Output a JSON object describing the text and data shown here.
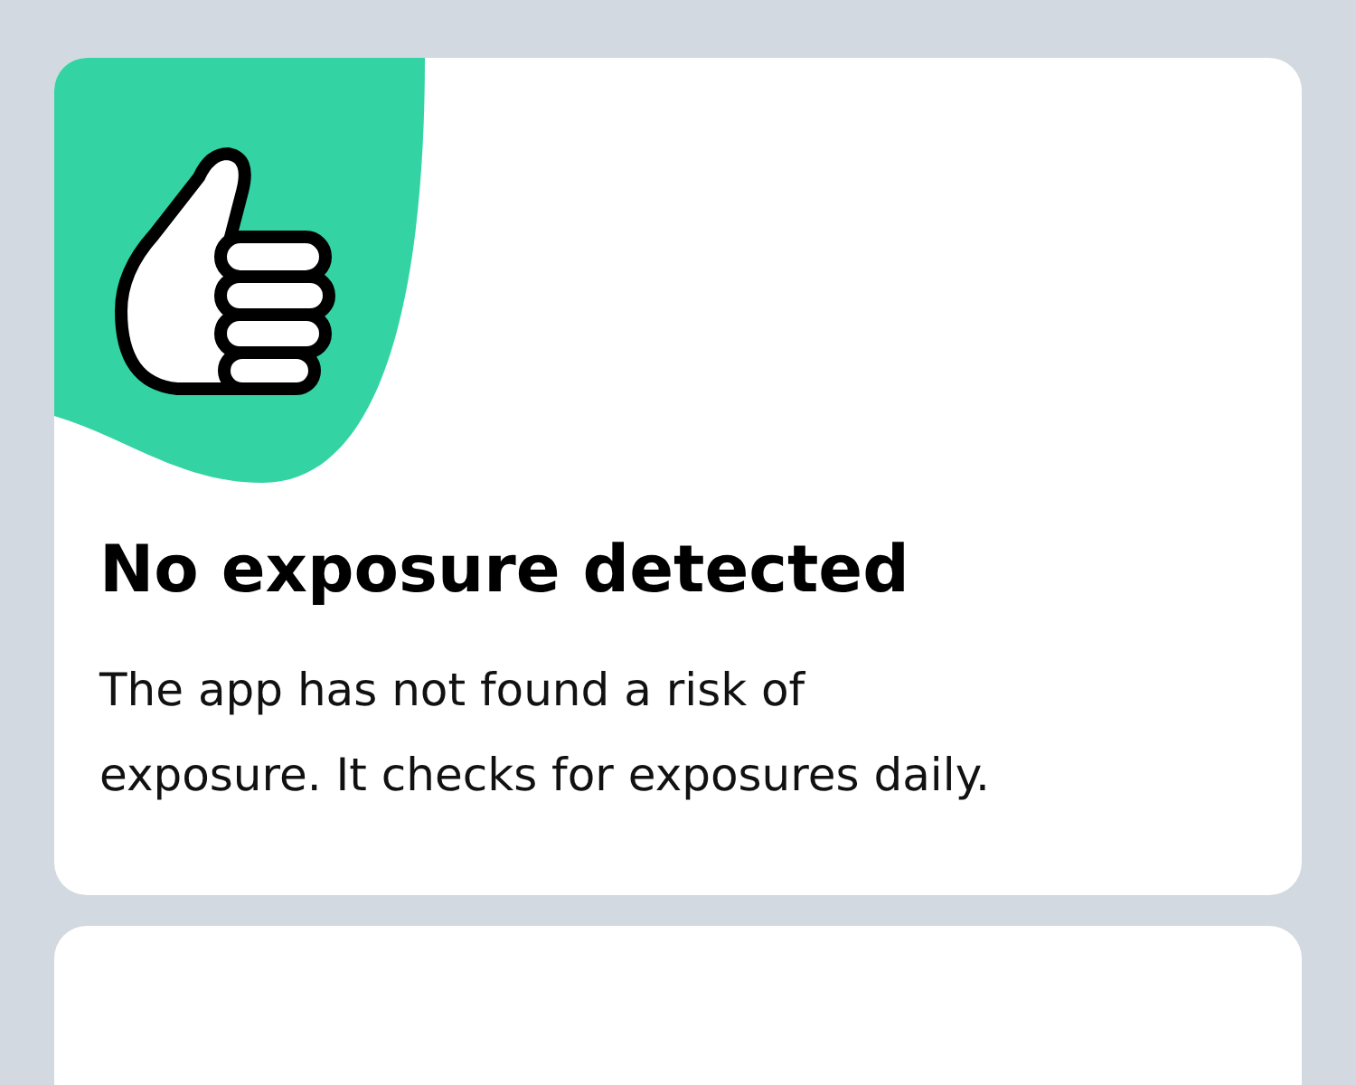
{
  "status_card": {
    "title": "No exposure detected",
    "description": "The app has not found a risk of\nexposure. It checks for exposures daily."
  },
  "next_card": {
    "kind": "empty"
  }
}
